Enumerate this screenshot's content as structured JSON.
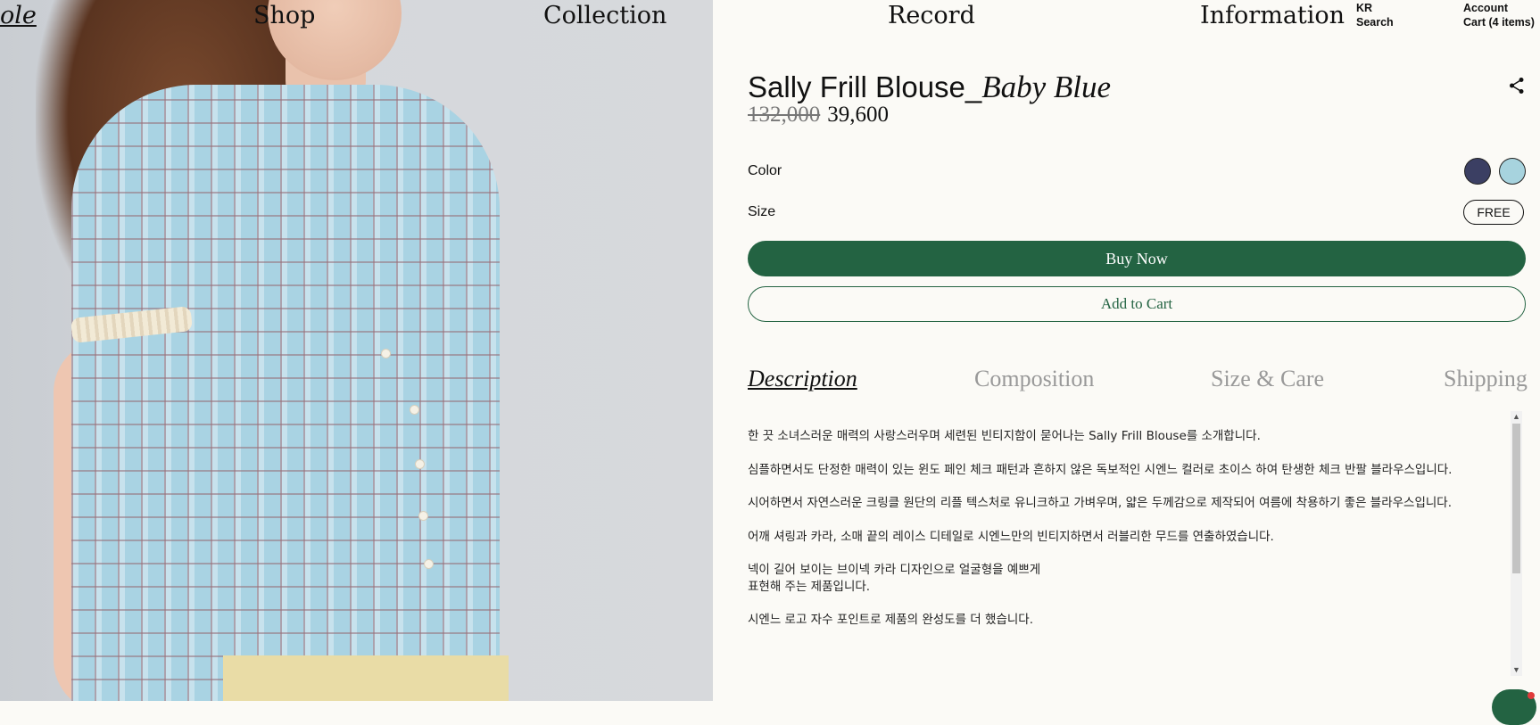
{
  "nav": {
    "brand_fragment": "ole",
    "links": [
      "Shop",
      "Collection",
      "Record",
      "Information"
    ],
    "lang": "KR",
    "search": "Search",
    "account": "Account",
    "cart": "Cart (4 items)"
  },
  "product": {
    "name": "Sally Frill Blouse_",
    "variant": "Baby Blue",
    "original_price": "132,000",
    "sale_price": "39,600",
    "color_label": "Color",
    "colors": [
      {
        "name": "navy",
        "hex": "#3b3f63"
      },
      {
        "name": "baby-blue",
        "hex": "#a7d3de"
      }
    ],
    "size_label": "Size",
    "size_value": "FREE",
    "buy_now": "Buy Now",
    "add_to_cart": "Add to Cart"
  },
  "tabs": [
    "Description",
    "Composition",
    "Size & Care",
    "Shipping"
  ],
  "description": [
    "한 끗 소녀스러운 매력의 사랑스러우며 세련된 빈티지함이 묻어나는 Sally Frill Blouse를 소개합니다.",
    "심플하면서도 단정한 매력이 있는 윈도 페인 체크 패턴과 흔하지 않은 독보적인 시엔느 컬러로 초이스 하여 탄생한 체크 반팔 블라우스입니다.",
    "시어하면서 자연스러운 크링클 원단의 리플 텍스처로 유니크하고 가벼우며, 얇은 두께감으로 제작되어 여름에 착용하기 좋은 블라우스입니다.",
    "어깨 셔링과 카라, 소매 끝의 레이스 디테일로 시엔느만의 빈티지하면서 러블리한 무드를 연출하였습니다.",
    "넥이 길어 보이는 브이넥 카라 디자인으로 얼굴형을 예쁘게\n표현해 주는 제품입니다.",
    "시엔느 로고 자수 포인트로 제품의 완성도를 더 했습니다."
  ],
  "icons": {
    "share": "share-icon",
    "scroll_up": "chevron-up-icon",
    "scroll_down": "chevron-down-icon",
    "chat": "chat-icon"
  },
  "colors": {
    "primary_green": "#236342",
    "background": "#fbfaf6"
  }
}
